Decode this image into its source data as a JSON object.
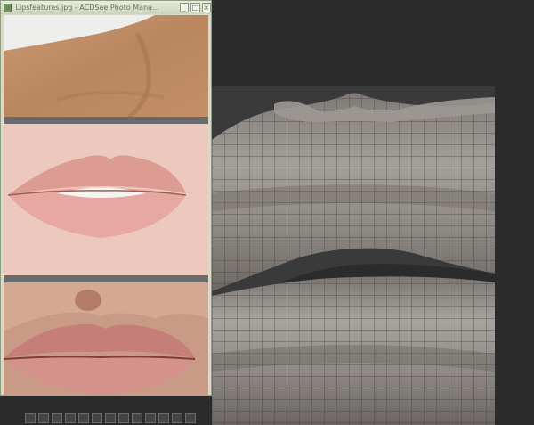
{
  "window": {
    "title": "Lipsfeatures.jpg - ACDSee Photo Mana...",
    "minimize_glyph": "_",
    "maximize_glyph": "□",
    "close_glyph": "×"
  },
  "photos": [
    {
      "icon": "neck-skin-photo"
    },
    {
      "icon": "lips-closed-photo"
    },
    {
      "icon": "lips-parted-photo"
    }
  ],
  "viewport": {
    "icon": "lip-mesh-wireframe"
  },
  "colors": {
    "window_chrome": "#d9d9c8",
    "viewport_bg": "#2b2b2b",
    "mesh_surface": "#8a8580"
  }
}
